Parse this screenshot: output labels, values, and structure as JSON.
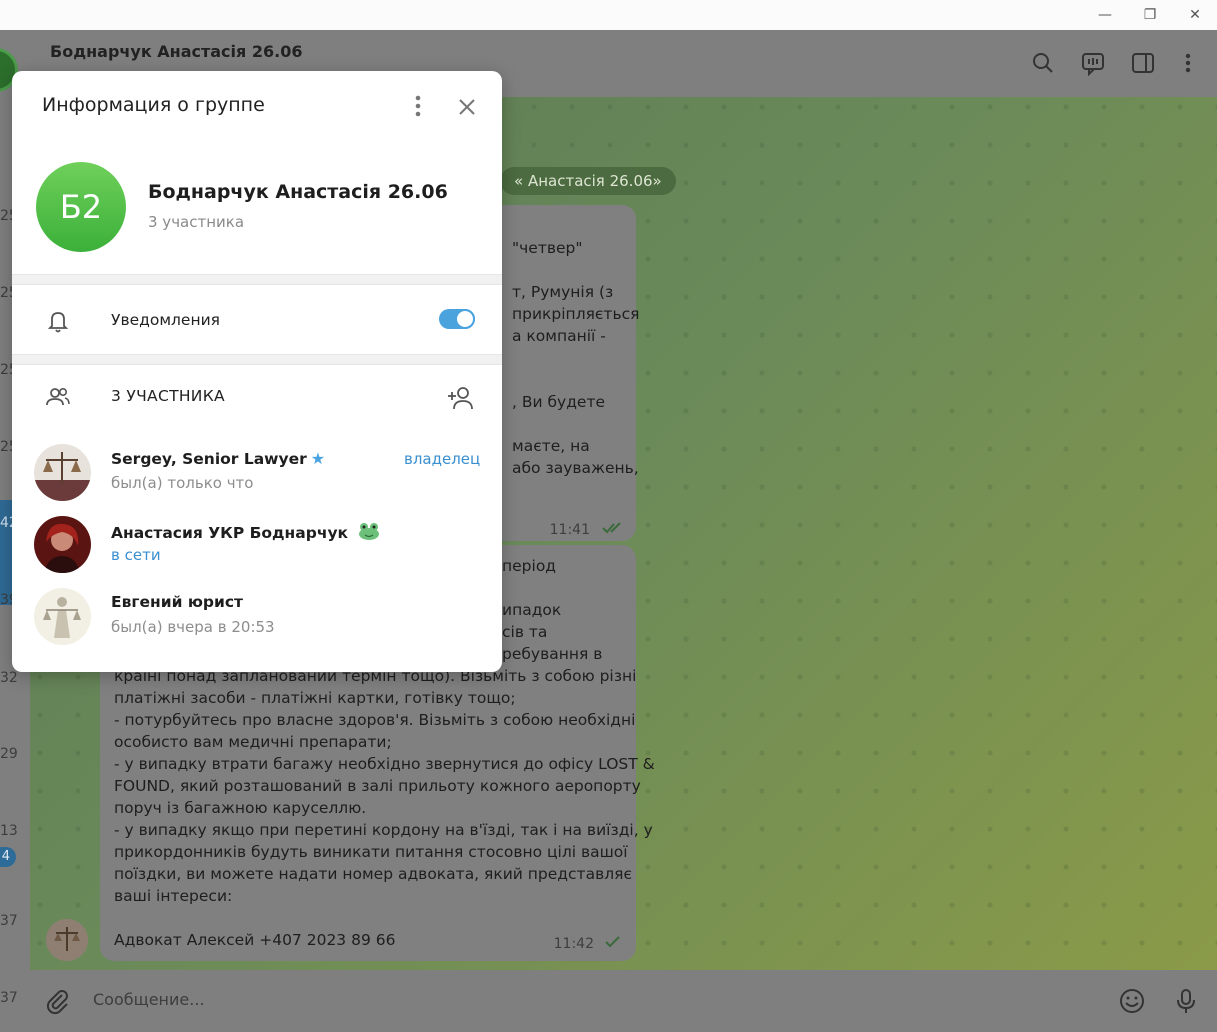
{
  "window": {
    "minimize": "—",
    "maximize": "❐",
    "close": "✕"
  },
  "chat_list_strip": {
    "numbers": [
      "25",
      "25",
      "25",
      "25",
      "42",
      "39",
      "32",
      "29",
      "13",
      "37",
      "37"
    ],
    "badge": "4"
  },
  "chat_header": {
    "title": "Боднарчук Анастасія 26.06"
  },
  "chat": {
    "date_chip": "« Анастасія 26.06»",
    "message1": {
      "lines": [
        "\"четвер\"",
        "",
        "т, Румунія (з",
        "прикріпляється",
        "а компанії -",
        "",
        "",
        ", Ви будете",
        "",
        "маєте, на",
        "або зауважень,"
      ],
      "time": "11:41"
    },
    "message2": {
      "lines": [
        "період",
        "",
        "ипадок",
        "сів та",
        "ребування в",
        "країні понад запланований термін тощо). Візьміть з собою різні",
        "платіжні засоби - платіжні картки, готівку тощо;",
        "- потурбуйтесь про власне здоров'я. Візьміть з собою необхідні",
        "особисто вам медичні препарати;",
        "- у випадку втрати багажу необхідно звернутися до офісу LOST &",
        "FOUND, який розташований в залі прильоту кожного аеропорту",
        "поруч із багажною каруселлю.",
        "- у випадку якщо при перетині кордону на в'їзді, так і на виїзді, у",
        "прикордонників будуть виникати питання стосовно цілі вашої",
        "поїздки, ви можете надати номер адвоката, який представляє",
        "ваші інтереси:",
        "",
        "Адвокат Алексей +407 2023 89 66"
      ],
      "time": "11:42"
    }
  },
  "composer": {
    "placeholder": "Сообщение..."
  },
  "group_info": {
    "title": "Информация о группе",
    "avatar_initials": "Б2",
    "avatar_color": "#4fbf45",
    "name": "Боднарчук Анастасія 26.06",
    "subtitle": "3 участника",
    "notifications_label": "Уведомления",
    "notifications_enabled": true,
    "members_header": "3 УЧАСТНИКА",
    "members": [
      {
        "name": "Sergey, Senior Lawyer",
        "status": "был(а) только что",
        "role": "владелец",
        "verified_icon": "star-icon"
      },
      {
        "name": "Анастасия УКР Боднарчук",
        "status": "в сети",
        "emoji_icon": "frog-icon"
      },
      {
        "name": "Евгений юрист",
        "status": "был(а) вчера в 20:53"
      }
    ]
  },
  "colors": {
    "accent": "#4ba3dd",
    "online": "#3a8fd1",
    "chat_bubble": "#808080"
  }
}
